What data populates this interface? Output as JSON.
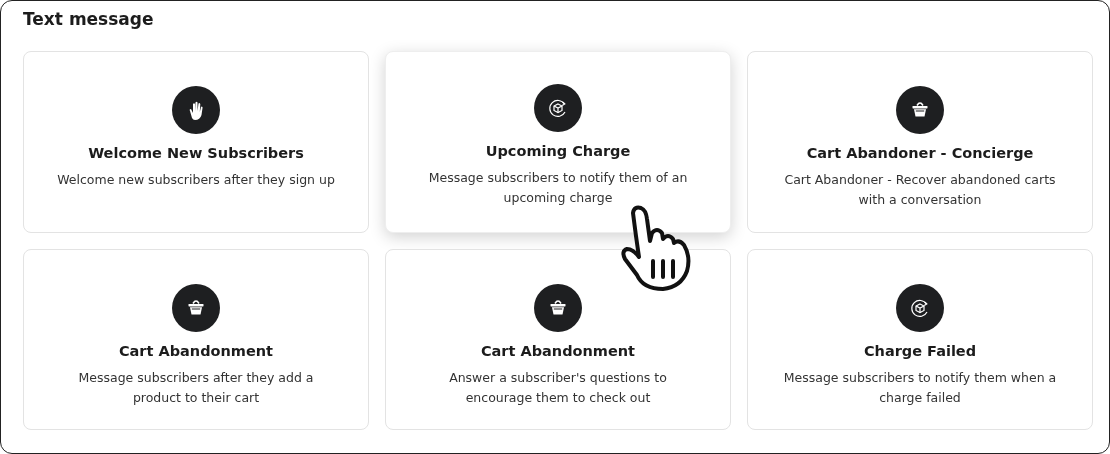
{
  "title": "Text message",
  "cards": [
    {
      "kind": "hand",
      "title": "Welcome New Subscribers",
      "description": "Welcome new subscribers after they sign up",
      "hovered": false
    },
    {
      "kind": "box",
      "title": "Upcoming Charge",
      "description": "Message subscribers to notify them of an upcoming charge",
      "hovered": true
    },
    {
      "kind": "basket",
      "title": "Cart Abandoner - Concierge",
      "description": "Cart Abandoner - Recover abandoned carts with a conversation",
      "hovered": false
    },
    {
      "kind": "basket",
      "title": "Cart Abandonment",
      "description": "Message subscribers after they add a product to their cart",
      "hovered": false
    },
    {
      "kind": "basket",
      "title": "Cart Abandonment",
      "description": "Answer a subscriber's questions to encourage them to check out",
      "hovered": false
    },
    {
      "kind": "box",
      "title": "Charge Failed",
      "description": "Message subscribers to notify them when a charge failed",
      "hovered": false
    }
  ]
}
